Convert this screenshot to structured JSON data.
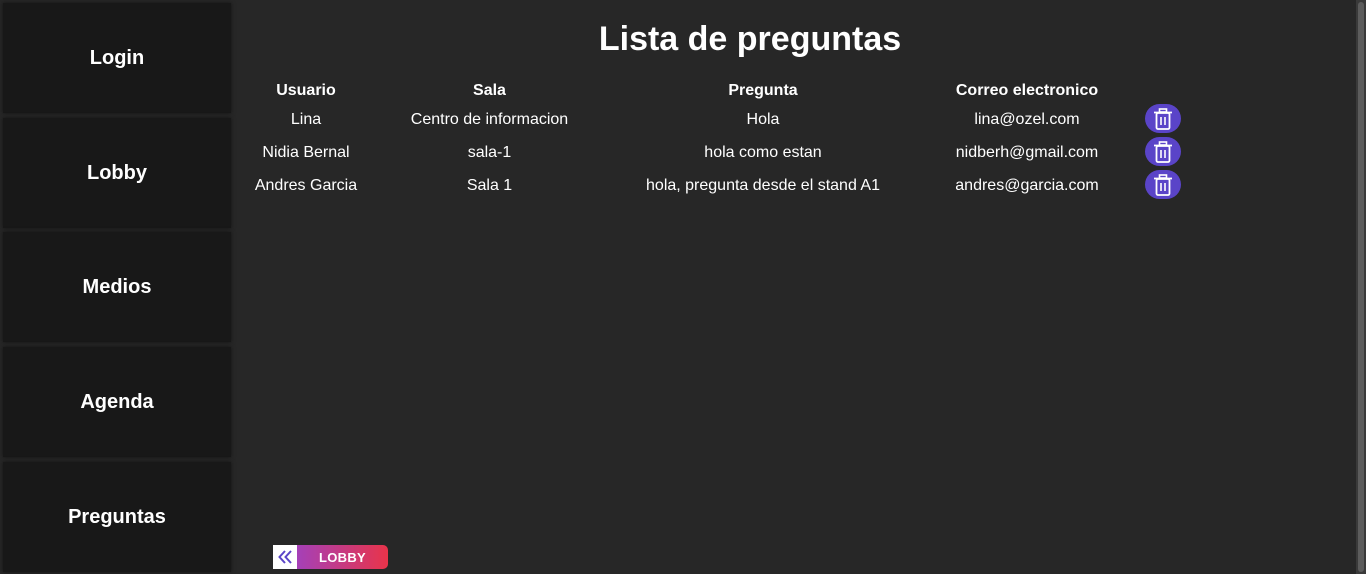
{
  "sidebar": {
    "items": [
      {
        "label": "Login"
      },
      {
        "label": "Lobby"
      },
      {
        "label": "Medios"
      },
      {
        "label": "Agenda"
      },
      {
        "label": "Preguntas"
      }
    ]
  },
  "main": {
    "title": "Lista de preguntas",
    "table": {
      "headers": [
        "Usuario",
        "Sala",
        "Pregunta",
        "Correo electronico"
      ],
      "rows": [
        {
          "usuario": "Lina",
          "sala": "Centro de informacion",
          "pregunta": "Hola",
          "correo": "lina@ozel.com"
        },
        {
          "usuario": "Nidia Bernal",
          "sala": "sala-1",
          "pregunta": "hola como estan",
          "correo": "nidberh@gmail.com"
        },
        {
          "usuario": "Andres Garcia",
          "sala": "Sala 1",
          "pregunta": "hola, pregunta desde el stand A1",
          "correo": "andres@garcia.com"
        }
      ],
      "delete_icon": "trash-icon"
    }
  },
  "back_button": {
    "label": "LOBBY",
    "icon": "double-chevron-left-icon"
  },
  "colors": {
    "background": "#272727",
    "sidebar_item": "#181818",
    "delete_button": "#5a44c8",
    "back_gradient_start": "#a540b8",
    "back_gradient_end": "#e8344a"
  }
}
